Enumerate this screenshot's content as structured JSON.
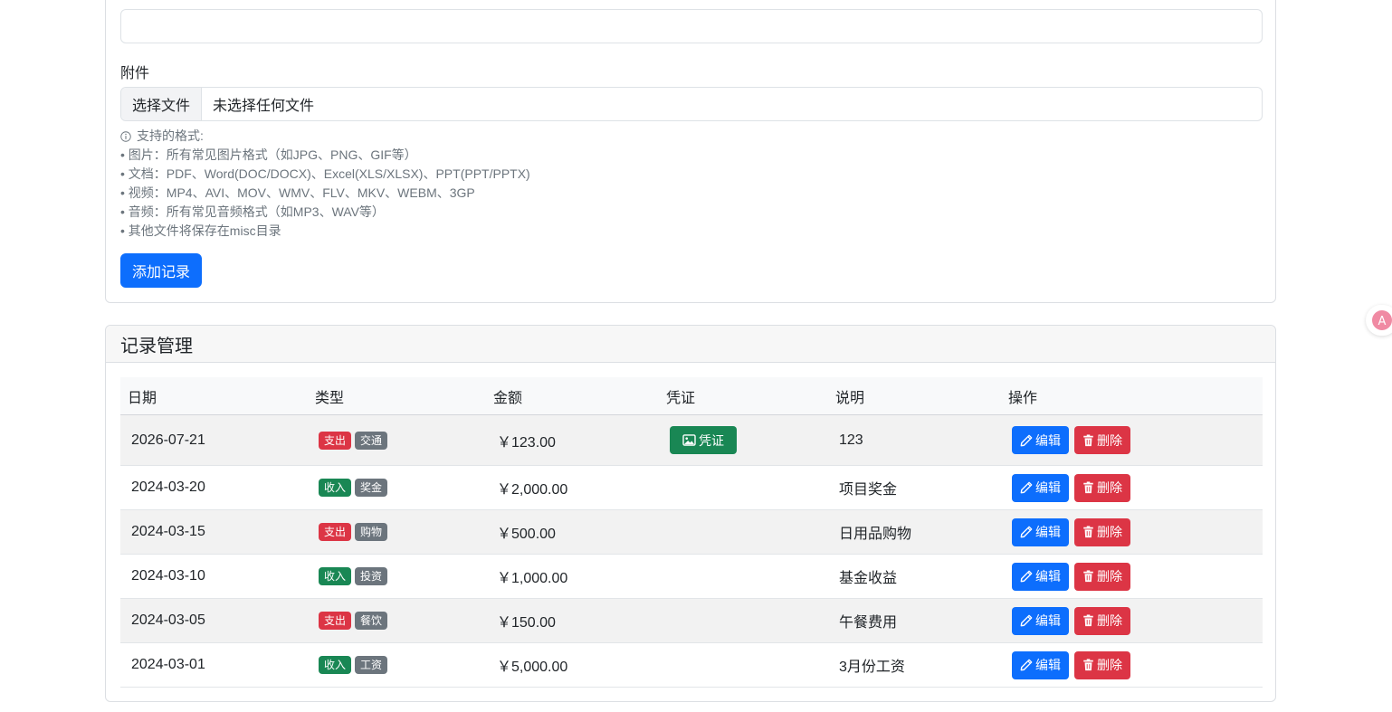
{
  "form": {
    "attachment_label": "附件",
    "file_button": "选择文件",
    "file_status": "未选择任何文件",
    "help_lines": [
      "支持的格式:",
      "• 图片：所有常见图片格式（如JPG、PNG、GIF等）",
      "• 文档：PDF、Word(DOC/DOCX)、Excel(XLS/XLSX)、PPT(PPT/PPTX)",
      "• 视频：MP4、AVI、MOV、WMV、FLV、MKV、WEBM、3GP",
      "• 音频：所有常见音频格式（如MP3、WAV等）",
      "• 其他文件将保存在misc目录"
    ],
    "submit_label": "添加记录"
  },
  "records": {
    "title": "记录管理",
    "columns": [
      "日期",
      "类型",
      "金额",
      "凭证",
      "说明",
      "操作"
    ],
    "voucher_label": "凭证",
    "edit_label": "编辑",
    "delete_label": "删除",
    "rows": [
      {
        "date": "2026-07-21",
        "type": "支出",
        "category": "交通",
        "amount": "￥123.00",
        "has_voucher": true,
        "note": "123"
      },
      {
        "date": "2024-03-20",
        "type": "收入",
        "category": "奖金",
        "amount": "￥2,000.00",
        "has_voucher": false,
        "note": "项目奖金"
      },
      {
        "date": "2024-03-15",
        "type": "支出",
        "category": "购物",
        "amount": "￥500.00",
        "has_voucher": false,
        "note": "日用品购物"
      },
      {
        "date": "2024-03-10",
        "type": "收入",
        "category": "投资",
        "amount": "￥1,000.00",
        "has_voucher": false,
        "note": "基金收益"
      },
      {
        "date": "2024-03-05",
        "type": "支出",
        "category": "餐饮",
        "amount": "￥150.00",
        "has_voucher": false,
        "note": "午餐费用"
      },
      {
        "date": "2024-03-01",
        "type": "收入",
        "category": "工资",
        "amount": "￥5,000.00",
        "has_voucher": false,
        "note": "3月份工资"
      }
    ]
  },
  "colors": {
    "primary": "#0d6efd",
    "success": "#198754",
    "danger": "#dc3545",
    "secondary": "#6c757d"
  },
  "icons": {
    "help": "info-icon",
    "voucher": "image-icon",
    "edit": "pencil-icon",
    "delete": "trash-icon",
    "floating": "translate-icon"
  }
}
